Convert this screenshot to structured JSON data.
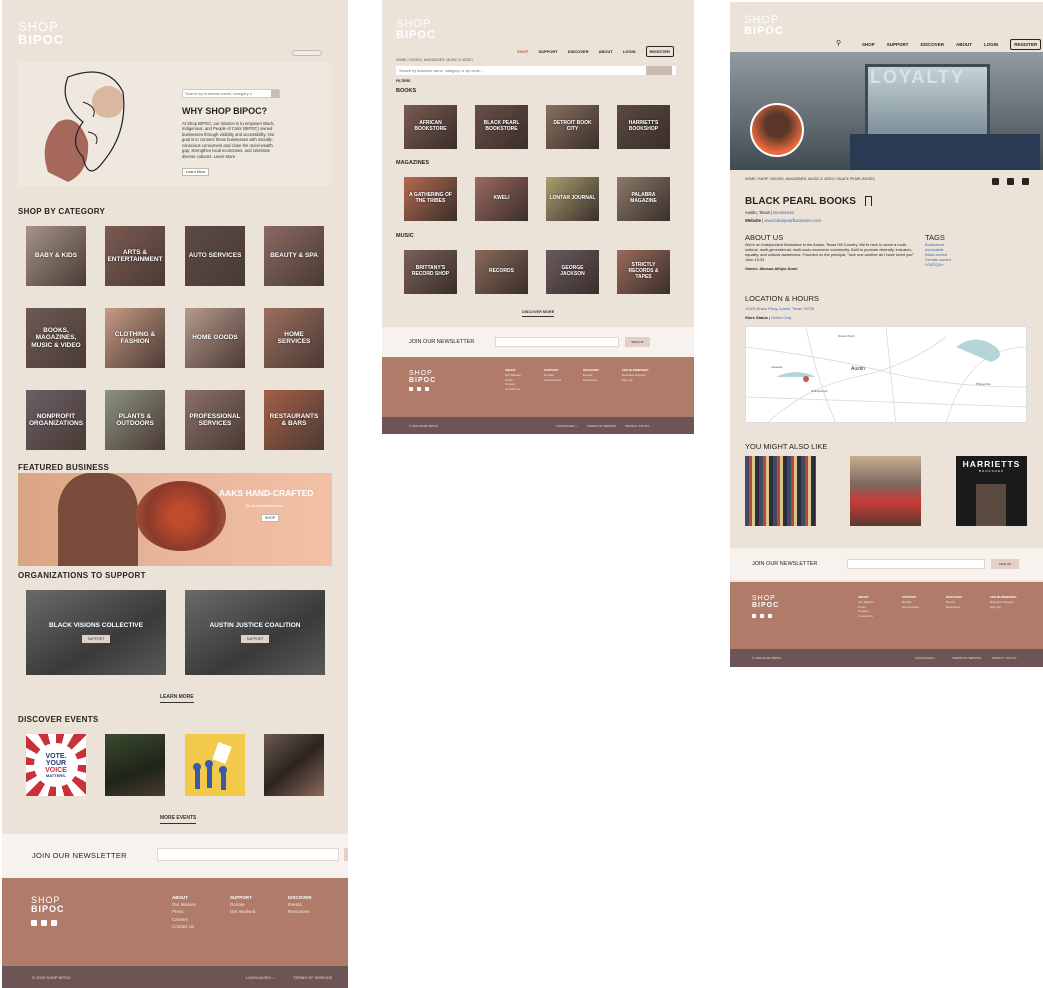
{
  "logo": {
    "line1": "SHOP",
    "line2": "BIPOC"
  },
  "home": {
    "search_placeholder": "Search by business name, category o",
    "header_button": "",
    "hero_title": "WHY SHOP BIPOC?",
    "hero_text": "At Shop BIPOC, our mission is to empower Black, Indigenous, and People of Color (BIPOC) owned businesses through visibility and accessibility. Our goal is to connect these businesses with socially-conscious consumers and close the racial wealth gap, strengthen local economies, and celebrate diverse cultures. Learn More",
    "hero_button": "Learn More",
    "categories_title": "SHOP BY CATEGORY",
    "categories": [
      {
        "label": "BABY & KIDS",
        "color": "#a69488"
      },
      {
        "label": "ARTS & ENTERTAINMENT",
        "color": "#7b5b52"
      },
      {
        "label": "AUTO SERVICES",
        "color": "#5c4a45"
      },
      {
        "label": "BEAUTY & SPA",
        "color": "#8a6a62"
      },
      {
        "label": "BOOKS, MAGAZINES, MUSIC & VIDEO",
        "color": "#6e5a55"
      },
      {
        "label": "CLOTHING & FASHION",
        "color": "#c79a84"
      },
      {
        "label": "HOME GOODS",
        "color": "#b79a8c"
      },
      {
        "label": "HOME SERVICES",
        "color": "#9c6e5e"
      },
      {
        "label": "NONPROFIT ORGANIZATIONS",
        "color": "#6b5f66"
      },
      {
        "label": "PLANTS & OUTDOORS",
        "color": "#8c9280"
      },
      {
        "label": "PROFESSIONAL SERVICES",
        "color": "#8a7068"
      },
      {
        "label": "RESTAURANTS & BARS",
        "color": "#a55e45"
      }
    ],
    "featured_title": "FEATURED BUSINESS",
    "featured_name": "AAKS HAND-CRAFTED",
    "featured_sub": "By Akosua Afriyie-Kumi",
    "featured_button": "SHOP",
    "orgs_title": "ORGANIZATIONS TO SUPPORT",
    "orgs": [
      {
        "label": "BLACK VISIONS COLLECTIVE",
        "button": "SUPPORT"
      },
      {
        "label": "AUSTIN JUSTICE COALITION",
        "button": "SUPPORT"
      }
    ],
    "learn_more": "LEARN MORE",
    "events_title": "DISCOVER EVENTS",
    "event_vote": [
      "VOTE.",
      "YOUR",
      "VOICE",
      "MATTERS."
    ],
    "more_events": "MORE EVENTS",
    "newsletter": "JOIN OUR NEWSLETTER",
    "footer_cols": [
      {
        "head": "ABOUT",
        "items": [
          "Our Mission",
          "Press",
          "Careers",
          "Contact Us"
        ]
      },
      {
        "head": "SUPPORT",
        "items": [
          "Donate",
          "Get Involved"
        ]
      },
      {
        "head": "DISCOVER",
        "items": [
          "Events",
          "Resources"
        ]
      }
    ],
    "copyright": "© 2020 SHOP BIPOC",
    "languages": "LANGUAGES",
    "terms": "TERMS OF SERVICE"
  },
  "shop": {
    "nav": [
      "SHOP",
      "SUPPORT",
      "DISCOVER",
      "ABOUT",
      "LOGIN"
    ],
    "register": "REGISTER",
    "breadcrumb": "HOME / BOOKS, MAGAZINES, MUSIC & VIDEO",
    "search_placeholder": "Search by business name, category, or zip code...",
    "filters": "FILTERS",
    "sections": [
      {
        "title": "BOOKS",
        "items": [
          "AFRICAN BOOKSTORE",
          "BLACK PEARL BOOKSTORE",
          "DETROIT BOOK CITY",
          "HARRIETT'S BOOKSHOP"
        ]
      },
      {
        "title": "MAGAZINES",
        "items": [
          "A GATHERING OF THE TRIBES",
          "KWELI",
          "LONTAR JOURNAL",
          "PALABRA MAGAZINE"
        ]
      },
      {
        "title": "MUSIC",
        "items": [
          "BRITTANY'S RECORD SHOP",
          "RECORDS",
          "GEORGE JACKSON",
          "STRICTLY RECORDS & TAPES"
        ]
      }
    ],
    "discover_more": "DISCOVER MORE",
    "newsletter": "JOIN OUR NEWSLETTER",
    "newsletter_button": "SIGN UP",
    "footer_cols": [
      {
        "head": "ABOUT",
        "items": [
          "Our Mission",
          "Press",
          "Careers",
          "Contact Us"
        ]
      },
      {
        "head": "SUPPORT",
        "items": [
          "Donate",
          "Get Involved"
        ]
      },
      {
        "head": "DISCOVER",
        "items": [
          "Events",
          "Resources"
        ]
      },
      {
        "head": "FOR BUSINESSES",
        "items": [
          "Business Support",
          "Sign Up"
        ]
      }
    ],
    "copyright": "© 2020 SHOP BIPOC",
    "languages": "LANGUAGES",
    "terms": "TERMS OF SERVICE",
    "privacy": "PRIVACY POLICY"
  },
  "detail": {
    "nav": [
      "SHOP",
      "SUPPORT",
      "DISCOVER",
      "ABOUT",
      "LOGIN"
    ],
    "register": "REGISTER",
    "storefront_sign": "LOYALTY",
    "breadcrumb": "HOME / SHOP / BOOKS, MAGAZINES, MUSIC & VIDEO / BLACK PEARL BOOKS",
    "name": "BLACK PEARL BOOKS",
    "location": "Austin, Texas",
    "location_category": "Bookstores",
    "website_label": "Website",
    "website": "www.blackpearlbookstore.com",
    "about_title": "ABOUT US",
    "about_text": "We're an Independent Bookstore in the Austin, Texas Hill Country. We're here to serve a multi-cultural, multi-generational, multi-socio-economic community. Built to promote diversity, inclusion, equality, and cultural awareness. Founded on the principal, \"love one another as I have loved you\" John 13:34",
    "owner": "Owner: Akosua Afriyie-Kumi",
    "tags_title": "TAGS",
    "tags": [
      "Bookstores",
      "Accessible",
      "Black-owned",
      "Female-owned",
      "LGBTQIA+"
    ],
    "location_title": "LOCATION & HOURS",
    "address": "12400 Bravo Pkwy, Austin, Texas 78726",
    "store_status_label": "Store Status",
    "store_status": "Online Only",
    "map_labels": [
      "Austin",
      "Lakeway",
      "Rollingwood",
      "Round Rock",
      "Pflugerville"
    ],
    "also_like_title": "YOU MIGHT ALSO LIKE",
    "harriett_sign": "HARRIETTS",
    "harriett_sub": "BOOKSHOP",
    "newsletter": "JOIN OUR NEWSLETTER",
    "newsletter_button": "SIGN UP",
    "footer_cols": [
      {
        "head": "ABOUT",
        "items": [
          "Our Mission",
          "Press",
          "Careers",
          "Contact Us"
        ]
      },
      {
        "head": "SUPPORT",
        "items": [
          "Donate",
          "Get Involved"
        ]
      },
      {
        "head": "DISCOVER",
        "items": [
          "Events",
          "Resources"
        ]
      },
      {
        "head": "FOR BUSINESSES",
        "items": [
          "Business Support",
          "Sign Up"
        ]
      }
    ],
    "copyright": "© 2020 SHOP BIPOC",
    "languages": "LANGUAGES",
    "terms": "TERMS OF SERVICE",
    "privacy": "PRIVACY POLICY"
  }
}
